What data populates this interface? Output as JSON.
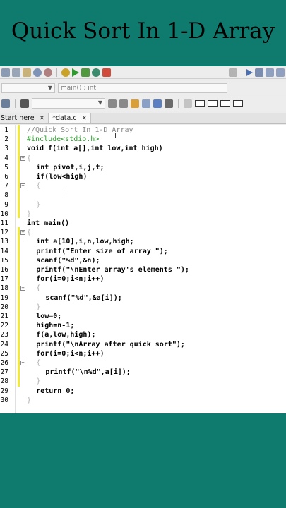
{
  "title": "Quick Sort In 1-D Array",
  "toolbar2": {
    "scope_combo": "",
    "symbol_combo": "main() : int"
  },
  "tabs": [
    {
      "label": "Start here",
      "close": "✕"
    },
    {
      "label": "*data.c",
      "close": "✕"
    }
  ],
  "code_lines": [
    {
      "n": "1",
      "text": "//Quick Sort In 1-D Array",
      "kind": "cmt",
      "indent": 0
    },
    {
      "n": "2",
      "text": "#include<stdio.h>",
      "kind": "pre",
      "indent": 0
    },
    {
      "n": "3",
      "text": "void f(int a[],int low,int high)",
      "kind": "kw",
      "indent": 0
    },
    {
      "n": "4",
      "text": "{",
      "kind": "brace",
      "indent": 0
    },
    {
      "n": "5",
      "text": "int pivot,i,j,t;",
      "kind": "kw",
      "indent": 2
    },
    {
      "n": "6",
      "text": "if(low<high)",
      "kind": "kw",
      "indent": 2
    },
    {
      "n": "7",
      "text": "{",
      "kind": "brace",
      "indent": 2
    },
    {
      "n": "8",
      "text": "",
      "kind": "kw",
      "indent": 4
    },
    {
      "n": "9",
      "text": "}",
      "kind": "brace",
      "indent": 2
    },
    {
      "n": "10",
      "text": "}",
      "kind": "brace",
      "indent": 0
    },
    {
      "n": "11",
      "text": "int main()",
      "kind": "kw",
      "indent": 0
    },
    {
      "n": "12",
      "text": "{",
      "kind": "brace",
      "indent": 0
    },
    {
      "n": "13",
      "text": "int a[10],i,n,low,high;",
      "kind": "kw",
      "indent": 2
    },
    {
      "n": "14",
      "text": "printf(\"Enter size of array \");",
      "kind": "kw",
      "indent": 2
    },
    {
      "n": "15",
      "text": "scanf(\"%d\",&n);",
      "kind": "kw",
      "indent": 2
    },
    {
      "n": "16",
      "text": "printf(\"\\nEnter array's elements \");",
      "kind": "kw",
      "indent": 2
    },
    {
      "n": "17",
      "text": "for(i=0;i<n;i++)",
      "kind": "kw",
      "indent": 2
    },
    {
      "n": "18",
      "text": "{",
      "kind": "brace",
      "indent": 2
    },
    {
      "n": "19",
      "text": "scanf(\"%d\",&a[i]);",
      "kind": "kw",
      "indent": 4
    },
    {
      "n": "20",
      "text": "}",
      "kind": "brace",
      "indent": 2
    },
    {
      "n": "21",
      "text": "low=0;",
      "kind": "kw",
      "indent": 2
    },
    {
      "n": "22",
      "text": "high=n-1;",
      "kind": "kw",
      "indent": 2
    },
    {
      "n": "23",
      "text": "f(a,low,high);",
      "kind": "kw",
      "indent": 2
    },
    {
      "n": "24",
      "text": "printf(\"\\nArray after quick sort\");",
      "kind": "kw",
      "indent": 2
    },
    {
      "n": "25",
      "text": "for(i=0;i<n;i++)",
      "kind": "kw",
      "indent": 2
    },
    {
      "n": "26",
      "text": "{",
      "kind": "brace",
      "indent": 2
    },
    {
      "n": "27",
      "text": "printf(\"\\n%d\",a[i]);",
      "kind": "kw",
      "indent": 4
    },
    {
      "n": "28",
      "text": "}",
      "kind": "brace",
      "indent": 2
    },
    {
      "n": "29",
      "text": "return 0;",
      "kind": "kw",
      "indent": 2
    },
    {
      "n": "30",
      "text": "}",
      "kind": "brace",
      "indent": 0
    }
  ],
  "colors": {
    "background": "#0f7a6e",
    "comment": "#888888",
    "preprocessor": "#2a9a2a",
    "change_marker": "#f2e83c"
  }
}
